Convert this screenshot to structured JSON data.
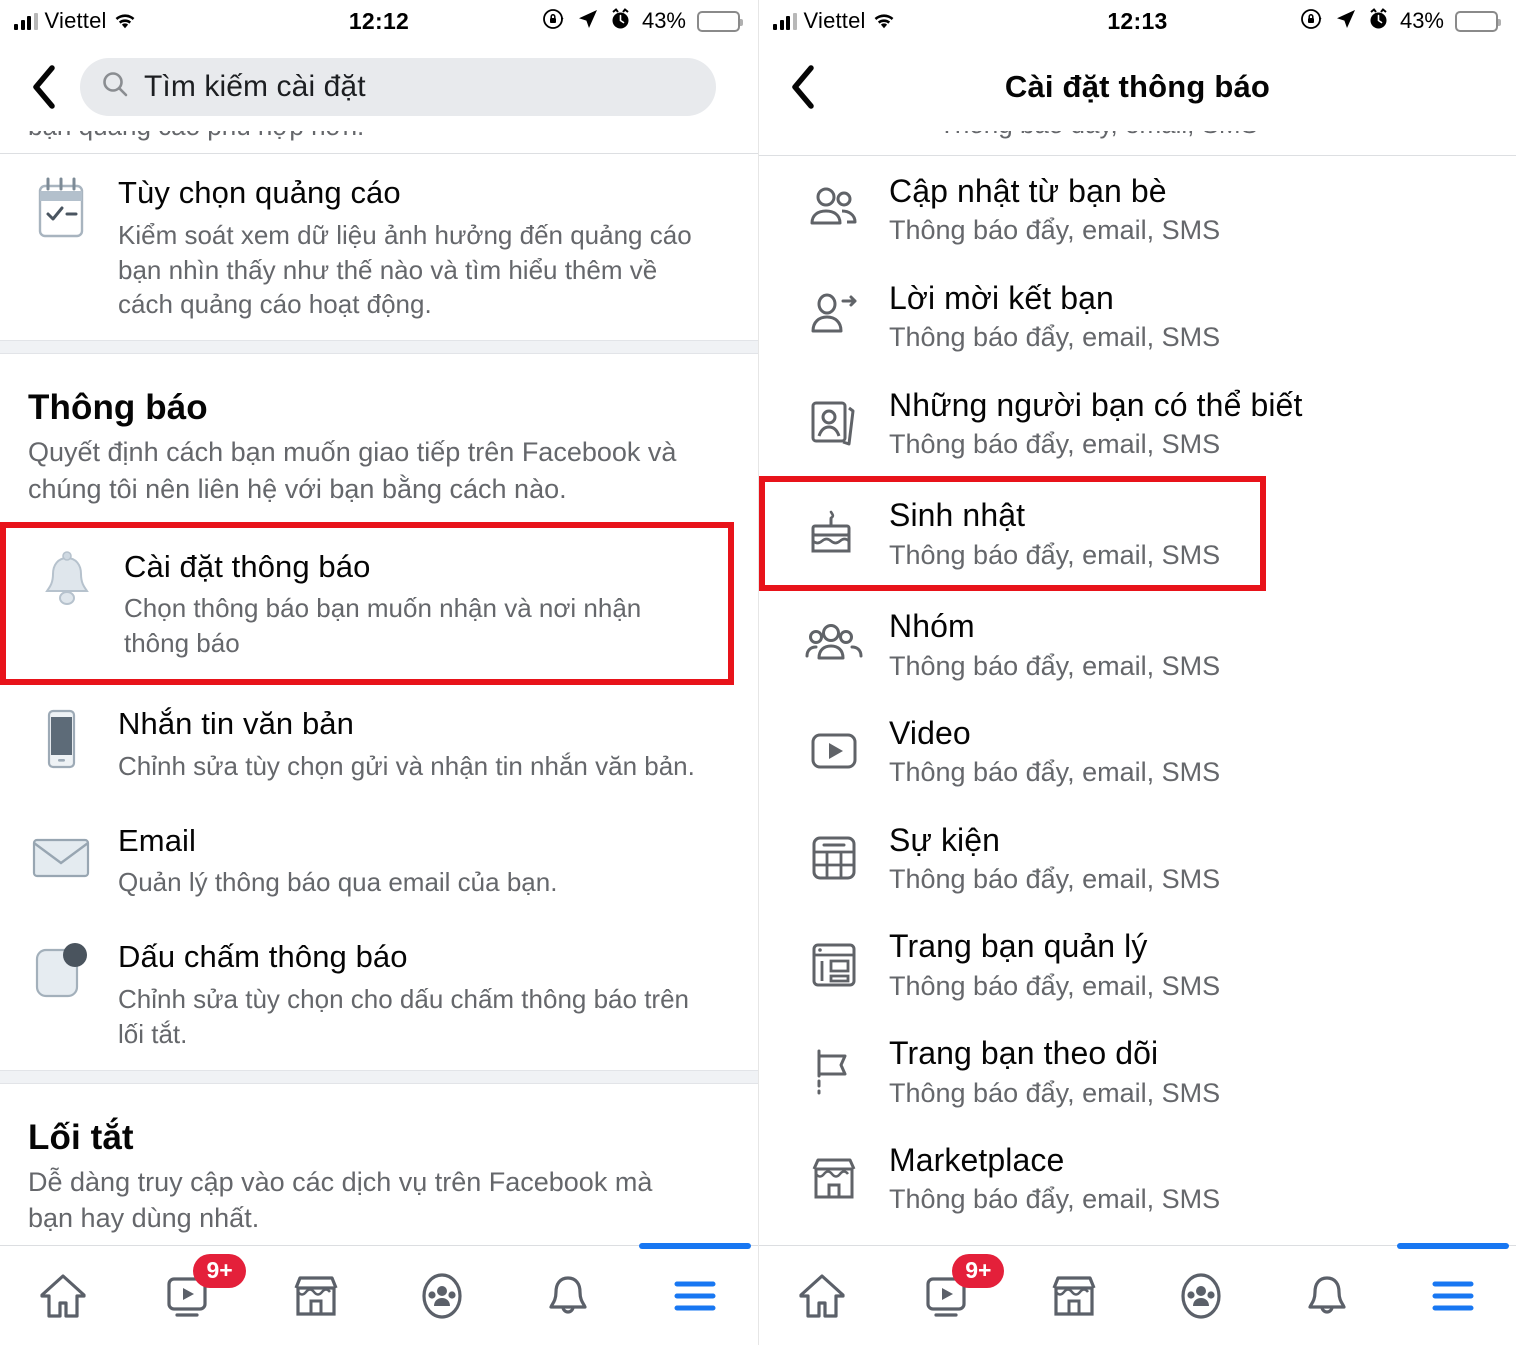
{
  "screens": [
    {
      "id": "settings-search",
      "status_bar": {
        "carrier": "Viettel",
        "time": "12:12",
        "battery_percent": "43%",
        "icons": [
          "signal-bars-icon",
          "wifi-icon",
          "rotation-lock-icon",
          "location-arrow-icon",
          "alarm-clock-icon",
          "battery-icon"
        ]
      },
      "header": {
        "back_icon": "back-chevron-icon",
        "search_icon": "search-icon",
        "search_placeholder": "Tìm kiếm cài đặt",
        "search_value": ""
      },
      "clipped_top_text": "bạn quảng cáo phù hợp hơn.",
      "ad_row": {
        "icon": "notepad-checklist-icon",
        "title": "Tùy chọn quảng cáo",
        "desc": "Kiểm soát xem dữ liệu ảnh hưởng đến quảng cáo bạn nhìn thấy như thế nào và tìm hiểu thêm về cách quảng cáo hoạt động."
      },
      "notifications_section": {
        "title": "Thông báo",
        "subtitle": "Quyết định cách bạn muốn giao tiếp trên Facebook và chúng tôi nên liên hệ với bạn bằng cách nào.",
        "items": [
          {
            "icon": "bell-icon",
            "title": "Cài đặt thông báo",
            "desc": "Chọn thông báo bạn muốn nhận và nơi nhận thông báo",
            "highlighted": true
          },
          {
            "icon": "phone-icon",
            "title": "Nhắn tin văn bản",
            "desc": "Chỉnh sửa tùy chọn gửi và nhận tin nhắn văn bản.",
            "highlighted": false
          },
          {
            "icon": "envelope-icon",
            "title": "Email",
            "desc": "Quản lý thông báo qua email của bạn.",
            "highlighted": false
          },
          {
            "icon": "notification-dot-icon",
            "title": "Dấu chấm thông báo",
            "desc": "Chỉnh sửa tùy chọn cho dấu chấm thông báo trên lối tắt.",
            "highlighted": false
          }
        ]
      },
      "shortcuts_section": {
        "title": "Lối tắt",
        "subtitle": "Dễ dàng truy cập vào các dịch vụ trên Facebook mà bạn hay dùng nhất."
      }
    },
    {
      "id": "notification-settings",
      "status_bar": {
        "carrier": "Viettel",
        "time": "12:13",
        "battery_percent": "43%",
        "icons": [
          "signal-bars-icon",
          "wifi-icon",
          "rotation-lock-icon",
          "location-arrow-icon",
          "alarm-clock-icon",
          "battery-icon"
        ]
      },
      "header": {
        "back_icon": "back-chevron-icon",
        "title": "Cài đặt thông báo"
      },
      "clipped_top_text": "Thông báo đẩy, email, SMS",
      "items": [
        {
          "icon": "two-people-icon",
          "title": "Cập nhật từ bạn bè",
          "desc": "Thông báo đẩy, email, SMS",
          "highlighted": false
        },
        {
          "icon": "person-arrow-icon",
          "title": "Lời mời kết bạn",
          "desc": "Thông báo đẩy, email, SMS",
          "highlighted": false
        },
        {
          "icon": "contact-cards-icon",
          "title": "Những người bạn có thể biết",
          "desc": "Thông báo đẩy, email, SMS",
          "highlighted": false
        },
        {
          "icon": "birthday-cake-icon",
          "title": "Sinh nhật",
          "desc": "Thông báo đẩy, email, SMS",
          "highlighted": true
        },
        {
          "icon": "group-people-icon",
          "title": "Nhóm",
          "desc": "Thông báo đẩy, email, SMS",
          "highlighted": false
        },
        {
          "icon": "video-play-icon",
          "title": "Video",
          "desc": "Thông báo đẩy, email, SMS",
          "highlighted": false
        },
        {
          "icon": "calendar-grid-icon",
          "title": "Sự kiện",
          "desc": "Thông báo đẩy, email, SMS",
          "highlighted": false
        },
        {
          "icon": "page-layout-icon",
          "title": "Trang bạn quản lý",
          "desc": "Thông báo đẩy, email, SMS",
          "highlighted": false
        },
        {
          "icon": "flag-icon",
          "title": "Trang bạn theo dõi",
          "desc": "Thông báo đẩy, email, SMS",
          "highlighted": false
        },
        {
          "icon": "storefront-icon",
          "title": "Marketplace",
          "desc": "Thông báo đẩy, email, SMS",
          "highlighted": false
        }
      ]
    }
  ],
  "tabbar": {
    "badge": "9+",
    "active_index": 5,
    "tabs": [
      {
        "icon": "home-icon",
        "name": "home"
      },
      {
        "icon": "watch-video-icon",
        "name": "watch"
      },
      {
        "icon": "marketplace-icon",
        "name": "marketplace"
      },
      {
        "icon": "groups-icon",
        "name": "groups"
      },
      {
        "icon": "notifications-bell-icon",
        "name": "notifications"
      },
      {
        "icon": "hamburger-menu-icon",
        "name": "menu"
      }
    ]
  },
  "colors": {
    "accent": "#1877f2",
    "highlight": "#e8131a",
    "badge": "#e4203a",
    "battery": "#fcd12a",
    "text_primary": "#050505",
    "text_secondary": "#65676b"
  }
}
